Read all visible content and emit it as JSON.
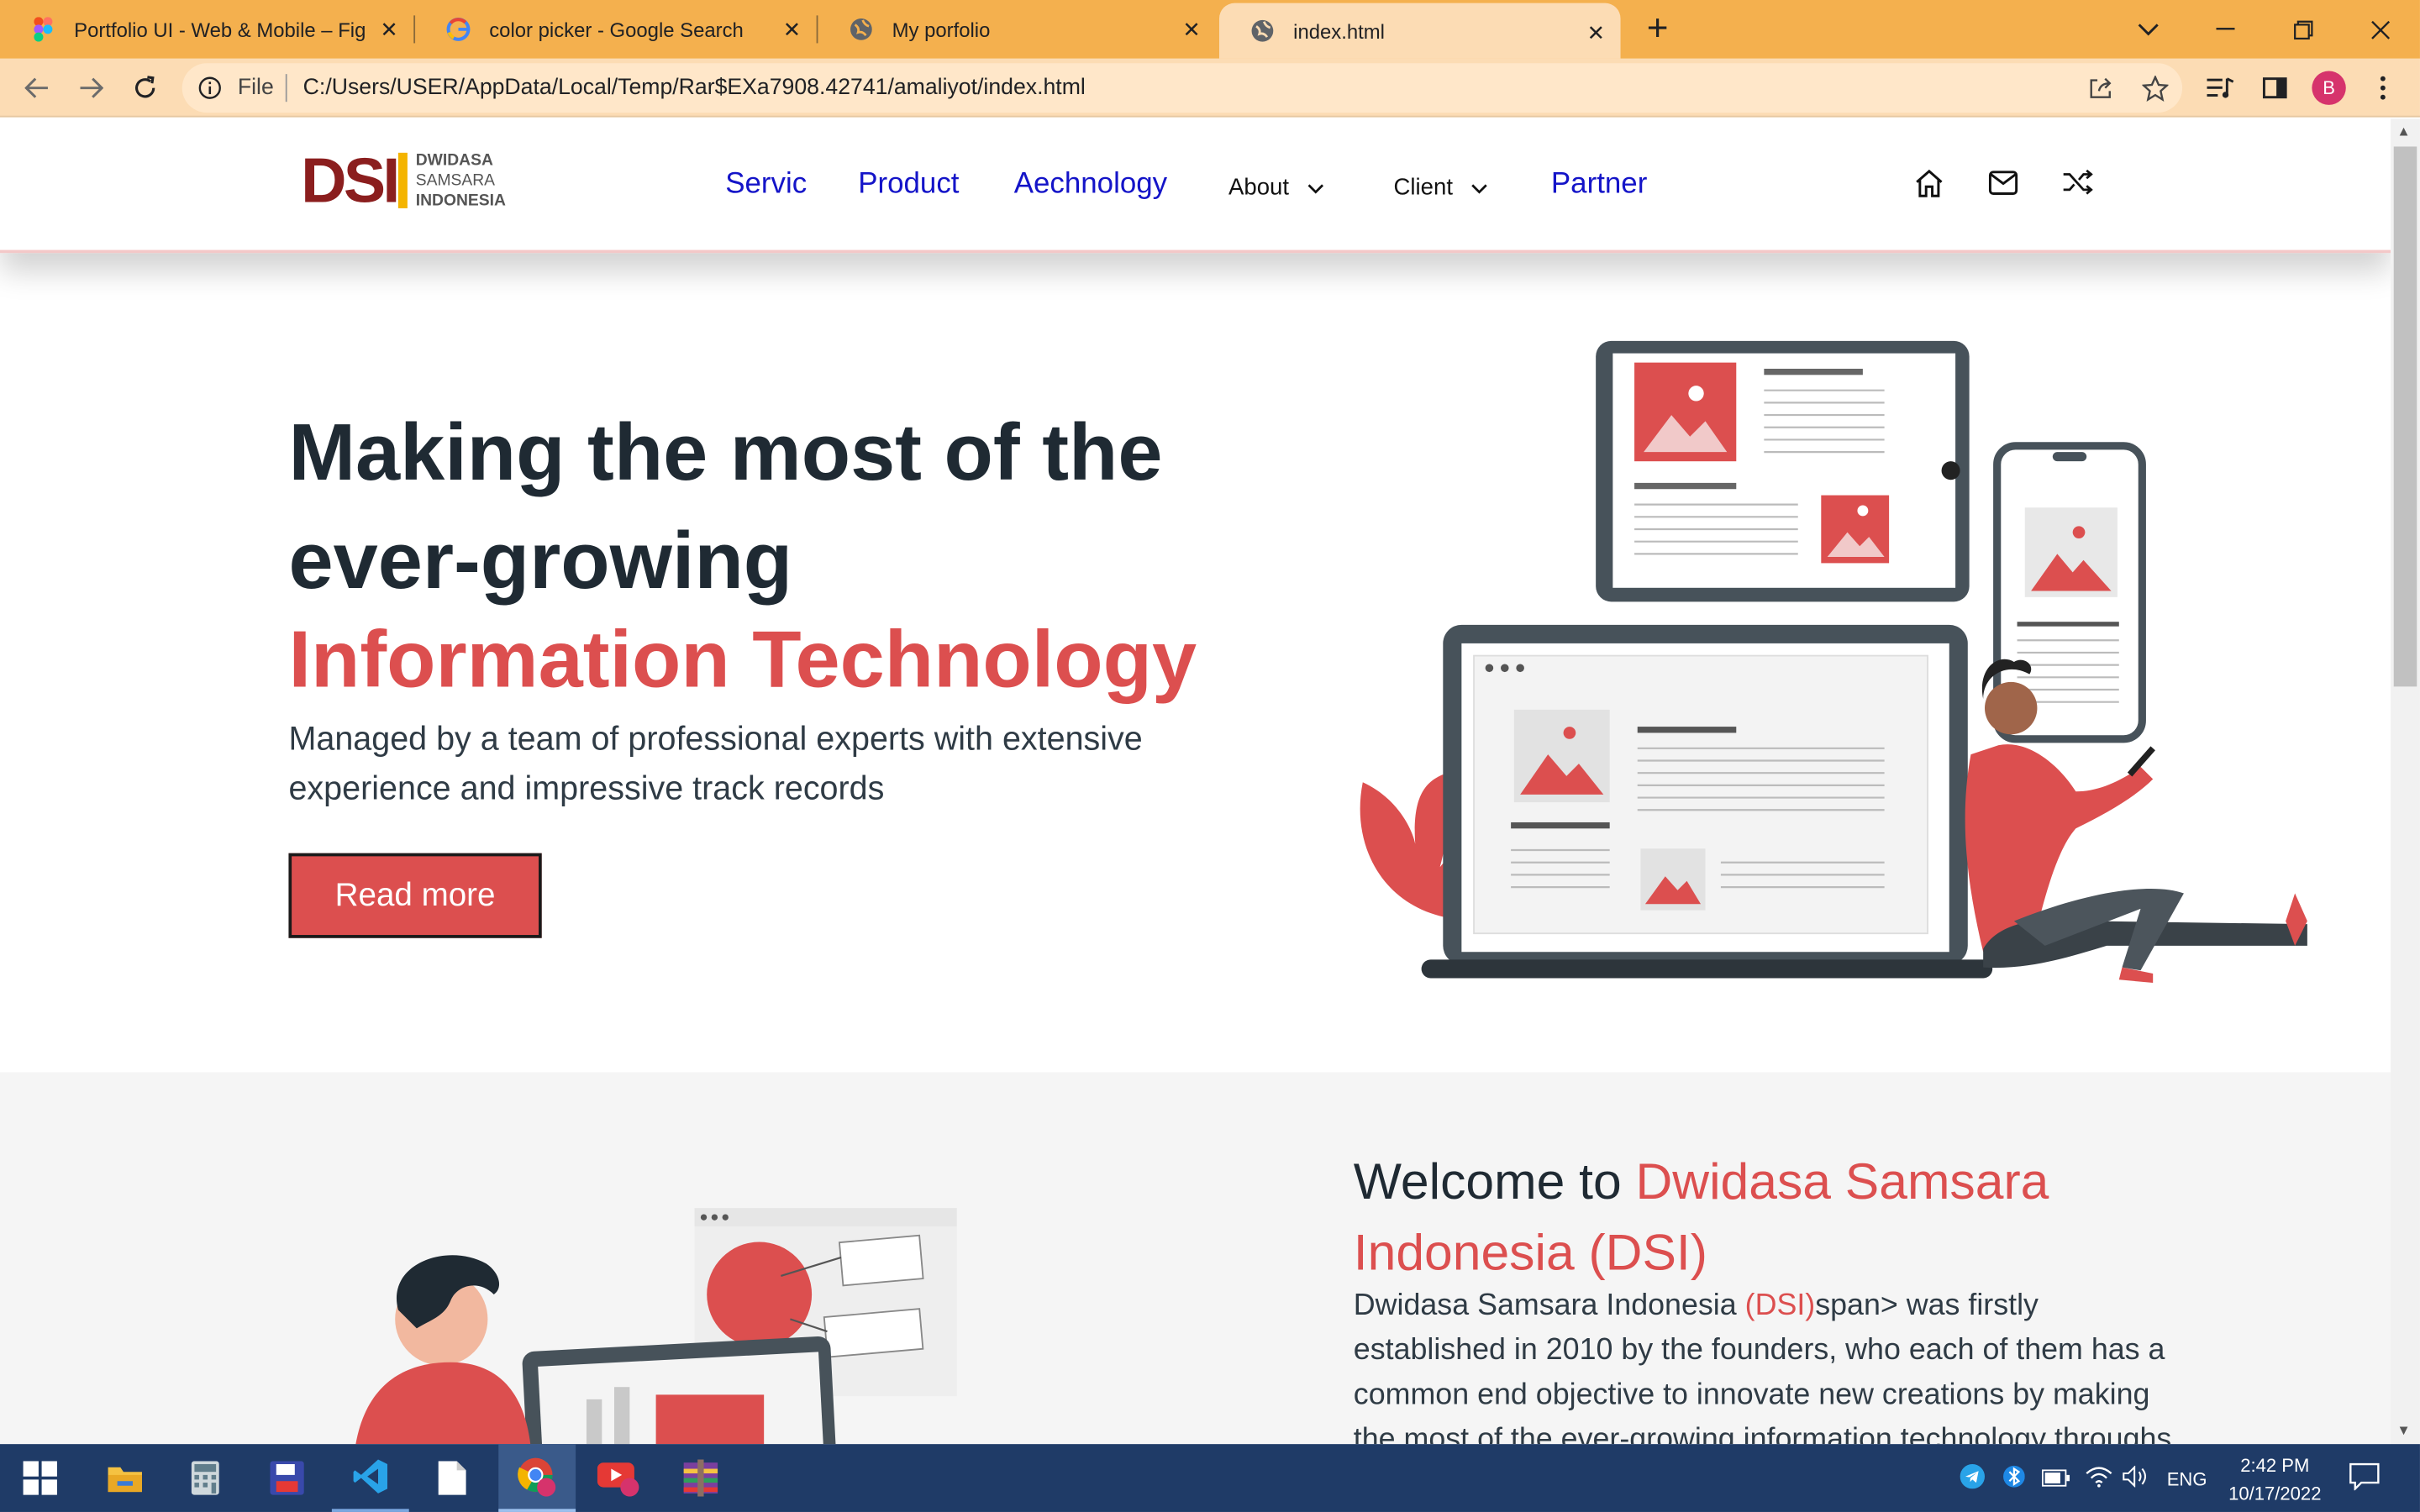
{
  "browser": {
    "tabs": [
      {
        "title": "Portfolio UI - Web & Mobile – Fig",
        "icon": "figma-icon"
      },
      {
        "title": "color picker - Google Search",
        "icon": "google-icon"
      },
      {
        "title": "My porfolio",
        "icon": "globe-icon"
      },
      {
        "title": "index.html",
        "icon": "globe-icon",
        "active": true
      }
    ],
    "new_tab": "+",
    "address_scheme": "File",
    "address_url": "C:/Users/USER/AppData/Local/Temp/Rar$EXa7908.42741/amaliyot/index.html",
    "profile_initial": "B",
    "colors": {
      "tabstrip": "#f4b04e",
      "toolbar": "#fcdcb4"
    }
  },
  "site": {
    "logo": {
      "mark": "DSI",
      "line1": "DWIDASA",
      "line2": "SAMSARA",
      "line3": "INDONESIA"
    },
    "nav": {
      "servic": "Servic",
      "product": "Product",
      "aechnology": "Aechnology",
      "about": "About",
      "client": "Client",
      "partner": "Partner"
    },
    "nav_icons": [
      "home-icon",
      "mail-icon",
      "shuffle-icon"
    ],
    "hero": {
      "heading": "Making the most of the ever-growing",
      "highlight": "Information Technology",
      "subtitle": "Managed by a team of professional experts with extensive experience and impressive track records",
      "cta": "Read more"
    },
    "welcome": {
      "prefix": "Welcome to ",
      "highlight": "Dwidasa Samsara Indonesia (DSI)",
      "body_start": "Dwidasa Samsara Indonesia ",
      "body_red": "(DSI)",
      "body_rest": "span> was firstly established in 2010 by the founders, who each of them has a common end objective to innovate new creations by making the most of the ever-growing information technology throughs"
    },
    "colors": {
      "accent": "#dc4f4f",
      "nav_link": "#1414c8",
      "heading": "#1f2a33"
    }
  },
  "taskbar": {
    "time": "2:42 PM",
    "date": "10/17/2022",
    "lang": "ENG",
    "apps": [
      "windows-start-icon",
      "file-explorer-icon",
      "calculator-icon",
      "save-disk-icon",
      "vscode-icon",
      "notepad-icon",
      "chrome-icon",
      "youtube-icon",
      "winrar-icon"
    ]
  }
}
